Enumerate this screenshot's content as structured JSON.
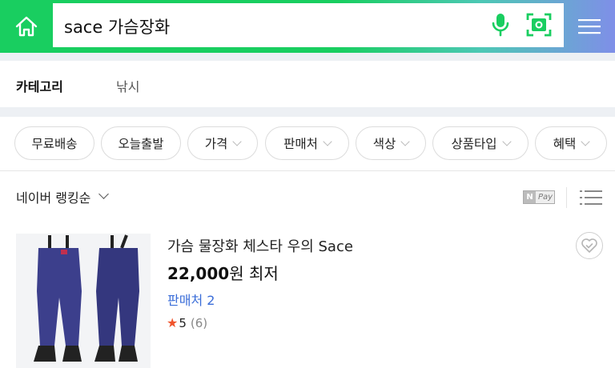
{
  "header": {
    "search_query": "sace 가슴장화"
  },
  "category": {
    "label": "카테고리",
    "value": "낚시"
  },
  "filters": [
    "무료배송",
    "오늘출발",
    "가격",
    "판매처",
    "색상",
    "상품타입",
    "혜택"
  ],
  "sort": {
    "label": "네이버 랭킹순",
    "npay_badge": "Pay"
  },
  "product": {
    "title": "가슴 물장화 체스타 우의 Sace",
    "price": "22,000",
    "price_unit": "원 최저",
    "seller": "판매처 2",
    "rating": "5",
    "review_count": "(6)"
  },
  "colors": {
    "brand_green": "#19ce60",
    "seller_link": "#3a6dd8",
    "star": "#f0542c"
  }
}
